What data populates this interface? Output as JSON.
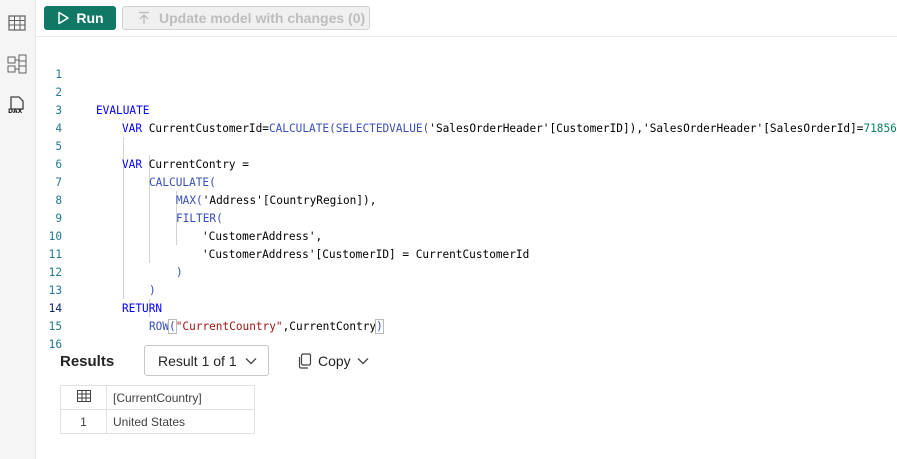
{
  "toolbar": {
    "run_label": "Run",
    "update_label": "Update model with changes (0)"
  },
  "rail": {
    "items": [
      {
        "icon": "table-view-icon"
      },
      {
        "icon": "model-view-icon"
      },
      {
        "icon": "dax-query-view-icon",
        "label": "DAX"
      }
    ]
  },
  "editor": {
    "active_line": 14,
    "lines": [
      {
        "n": "1"
      },
      {
        "n": "2"
      },
      {
        "n": "3"
      },
      {
        "n": "4"
      },
      {
        "n": "5"
      },
      {
        "n": "6"
      },
      {
        "n": "7"
      },
      {
        "n": "8"
      },
      {
        "n": "9"
      },
      {
        "n": "10"
      },
      {
        "n": "11"
      },
      {
        "n": "12"
      },
      {
        "n": "13"
      },
      {
        "n": "14"
      },
      {
        "n": "15"
      },
      {
        "n": "16"
      }
    ],
    "code": {
      "l2": "EVALUATE",
      "l3_var": "VAR",
      "l3_name": " CurrentCustomerId=",
      "l3_calc": "CALCULATE(",
      "l3_sel": "SELECTEDVALUE(",
      "l3_t1": "'SalesOrderHeader'",
      "l3_c1": "[CustomerID]),",
      "l3_t2": "'SalesOrderHeader'",
      "l3_c2": "[SalesOrderId]=",
      "l3_num": "71856",
      "l3_end": ")",
      "l5_var": "VAR",
      "l5_name": " CurrentContry =",
      "l6": "CALCULATE(",
      "l7_fn": "MAX(",
      "l7_t": "'Address'",
      "l7_c": "[CountryRegion]),",
      "l8": "FILTER(",
      "l9": "'CustomerAddress',",
      "l10_t": "'CustomerAddress'",
      "l10_c": "[CustomerID] = CurrentCustomerId",
      "l11": ")",
      "l12": ")",
      "l13": "RETURN",
      "l14_fn": "ROW",
      "l14_open": "(",
      "l14_str": "\"CurrentCountry\"",
      "l14_rest": ",CurrentContry",
      "l14_close": ")"
    }
  },
  "results": {
    "title": "Results",
    "selector": "Result 1 of 1",
    "copy_label": "Copy",
    "columns": [
      "[CurrentCountry]"
    ],
    "rows": [
      {
        "index": "1",
        "values": [
          "United States"
        ]
      }
    ]
  }
}
